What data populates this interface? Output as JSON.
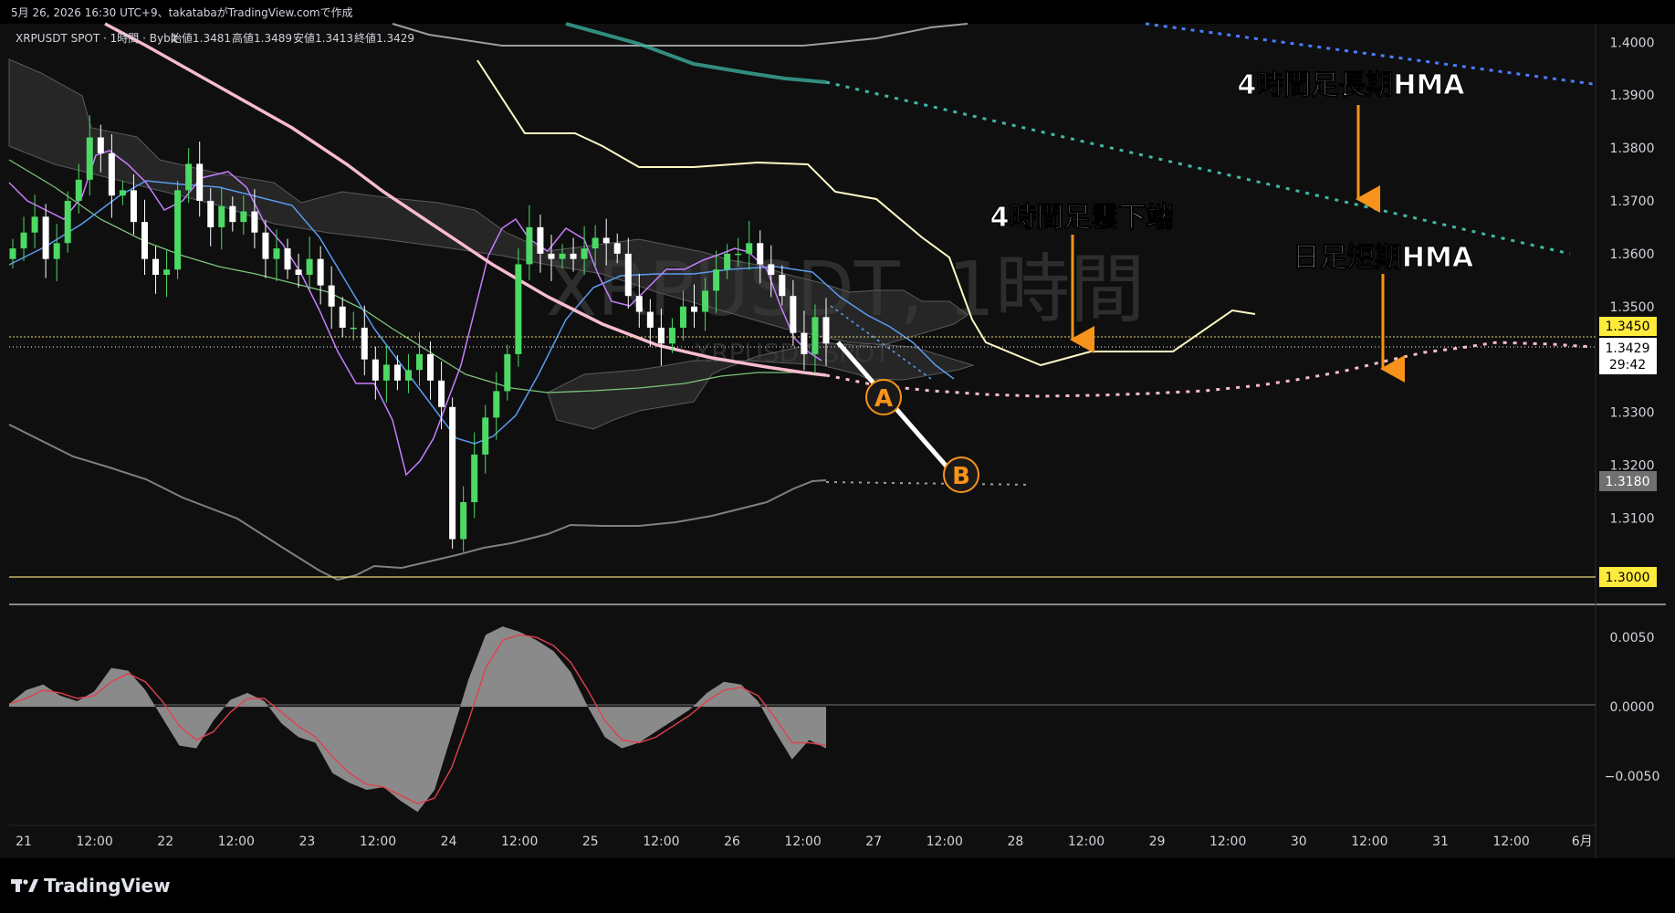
{
  "caption": "5月 26, 2026 16:30 UTC+9、takatabaがTradingView.comで作成",
  "logo_text": "TradingView",
  "colors": {
    "background": "#0f0f0f",
    "up": "#4cd964",
    "down": "#ffffff",
    "hma4h_long": "#4a7dff",
    "hma_trend_teal": "#3fb8a6",
    "hma_daily_short": "#f8bbd0",
    "cloud4h_lower": "#fff9c4",
    "bollinger": "#808080",
    "ma_fast": "#c77dff",
    "ma_mid": "#5b9bf0",
    "ma_slow": "#7cc47c",
    "accent_arrow": "#f7931a"
  },
  "chart_data": [
    {
      "type": "candlestick",
      "title": "XRPUSDT SPOT · 1時間 · Bybit",
      "watermark": {
        "line1": "XRPUSDT, 1時間",
        "line2": "XRPUSDT SPOT"
      },
      "ohlc_header": {
        "open_label": "始値",
        "open": "1.3481",
        "high_label": "高値",
        "high": "1.3489",
        "low_label": "安値",
        "low": "1.3413",
        "close_label": "終値",
        "close": "1.3429"
      },
      "x_tick_labels": [
        "21",
        "12:00",
        "22",
        "12:00",
        "23",
        "12:00",
        "24",
        "12:00",
        "25",
        "12:00",
        "26",
        "12:00",
        "27",
        "12:00",
        "28",
        "12:00",
        "29",
        "12:00",
        "30",
        "12:00",
        "31",
        "12:00",
        "6月"
      ],
      "y_range": [
        1.294,
        1.4035
      ],
      "y_ticks": [
        "1.4000",
        "1.3900",
        "1.3800",
        "1.3700",
        "1.3600",
        "1.3500",
        "1.3400",
        "1.3300",
        "1.3200",
        "1.3100"
      ],
      "price_labels": [
        {
          "price": 1.345,
          "text": "1.3450",
          "style": "yellow"
        },
        {
          "price": 1.3429,
          "text": "1.3429",
          "sub": "29:42",
          "style": "white"
        },
        {
          "price": 1.318,
          "text": "1.3180",
          "style": "gray"
        },
        {
          "price": 1.3,
          "text": "1.3000",
          "style": "yellow"
        }
      ],
      "horizontal_lines": [
        {
          "price": 1.345,
          "style": "dotted-yellow"
        },
        {
          "price": 1.3429,
          "style": "dotted-white"
        },
        {
          "price": 1.3,
          "style": "solid-yellow"
        }
      ],
      "close_samples": [
        1.361,
        1.364,
        1.367,
        1.359,
        1.362,
        1.37,
        1.374,
        1.382,
        1.379,
        1.371,
        1.372,
        1.366,
        1.359,
        1.356,
        1.357,
        1.372,
        1.377,
        1.37,
        1.365,
        1.369,
        1.366,
        1.368,
        1.364,
        1.359,
        1.361,
        1.357,
        1.356,
        1.359,
        1.354,
        1.35,
        1.346,
        1.346,
        1.34,
        1.336,
        1.339,
        1.336,
        1.338,
        1.341,
        1.336,
        1.331,
        1.306,
        1.313,
        1.322,
        1.329,
        1.334,
        1.341,
        1.358,
        1.365,
        1.36,
        1.359,
        1.36,
        1.359,
        1.361,
        1.363,
        1.362,
        1.36,
        1.352,
        1.349,
        1.346,
        1.343,
        1.346,
        1.35,
        1.349,
        1.353,
        1.357,
        1.36,
        1.36,
        1.362,
        1.358,
        1.356,
        1.352,
        1.345,
        1.341,
        1.348,
        1.343
      ],
      "annotations": [
        {
          "label": "4時間足長期HMA"
        },
        {
          "label": "4時間足雲下端"
        },
        {
          "label": "日足短期HMA"
        },
        {
          "label": "A"
        },
        {
          "label": "B"
        }
      ],
      "overlays": [
        "4時間足長期HMA",
        "4時間足雲下端",
        "日足短期HMA",
        "ボリンジャーバンド",
        "一目均衡表"
      ]
    },
    {
      "type": "line",
      "title": "",
      "y_ticks": [
        "0.0050",
        "0.0000",
        "−0.0050"
      ],
      "y_range": [
        -0.0083,
        0.0062
      ],
      "histogram": [
        0.0002,
        0.0012,
        0.0016,
        0.0008,
        0.0004,
        0.0011,
        0.0028,
        0.0026,
        0.0012,
        -0.0008,
        -0.0028,
        -0.003,
        -0.001,
        0.0005,
        0.001,
        0.0004,
        -0.0012,
        -0.0022,
        -0.0026,
        -0.0048,
        -0.0055,
        -0.006,
        -0.0058,
        -0.0068,
        -0.0076,
        -0.006,
        -0.002,
        0.002,
        0.0052,
        0.0058,
        0.0054,
        0.0048,
        0.004,
        0.0025,
        0.0,
        -0.0022,
        -0.003,
        -0.0026,
        -0.0018,
        -0.001,
        -0.0002,
        0.001,
        0.0018,
        0.0016,
        0.0004,
        -0.0018,
        -0.0038,
        -0.0024,
        -0.003
      ],
      "signal": [
        0.0002,
        0.0006,
        0.0012,
        0.001,
        0.0006,
        0.0008,
        0.0018,
        0.0024,
        0.0018,
        0.0004,
        -0.0014,
        -0.0024,
        -0.0018,
        -0.0004,
        0.0006,
        0.0006,
        -0.0004,
        -0.0014,
        -0.0022,
        -0.0036,
        -0.0048,
        -0.0056,
        -0.0058,
        -0.0064,
        -0.007,
        -0.0066,
        -0.0044,
        -0.001,
        0.0028,
        0.0048,
        0.0052,
        0.005,
        0.0044,
        0.0032,
        0.0012,
        -0.001,
        -0.0024,
        -0.0026,
        -0.0022,
        -0.0014,
        -0.0006,
        0.0004,
        0.0012,
        0.0014,
        0.0008,
        -0.0008,
        -0.0026,
        -0.0026,
        -0.0028
      ]
    }
  ]
}
